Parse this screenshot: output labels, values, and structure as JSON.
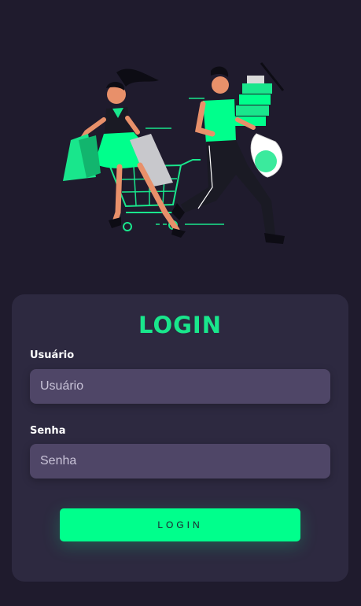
{
  "form": {
    "title": "LOGIN",
    "username_label": "Usuário",
    "username_placeholder": "Usuário",
    "password_label": "Senha",
    "password_placeholder": "Senha",
    "submit_label": "LOGIN"
  },
  "colors": {
    "background": "#1f1b2d",
    "card": "#2d2940",
    "input": "#4f4667",
    "accent": "#00ff8c",
    "title": "#19e68c"
  }
}
